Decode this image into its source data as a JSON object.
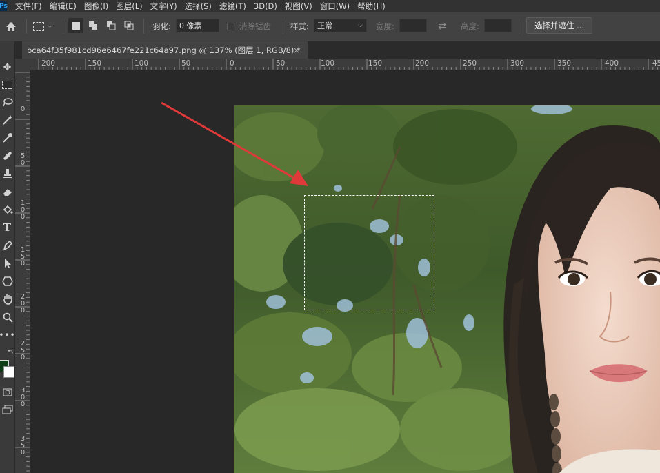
{
  "app": {
    "logo": "Ps"
  },
  "menu": [
    "文件(F)",
    "编辑(E)",
    "图像(I)",
    "图层(L)",
    "文字(Y)",
    "选择(S)",
    "滤镜(T)",
    "3D(D)",
    "视图(V)",
    "窗口(W)",
    "帮助(H)"
  ],
  "options": {
    "feather_label": "羽化:",
    "feather_value": "0 像素",
    "antialias_label": "消除锯齿",
    "style_label": "样式:",
    "style_value": "正常",
    "width_label": "宽度:",
    "height_label": "高度:",
    "select_mask_label": "选择并遮住 ..."
  },
  "document": {
    "tab_title": "bca64f35f981cd96e6467fe221c64a97.png @ 137% (图层 1, RGB/8) *",
    "close_glyph": "×"
  },
  "rulers": {
    "horizontal": [
      "200",
      "150",
      "100",
      "50",
      "0",
      "50",
      "100",
      "150",
      "200",
      "250",
      "300",
      "350",
      "400",
      "45"
    ],
    "vertical": [
      "0",
      "50",
      "100",
      "150",
      "200",
      "250",
      "300",
      "350"
    ]
  },
  "colors": {
    "foreground": "#0f3d16",
    "background": "#ffffff",
    "arrow": "#e0393a"
  },
  "icons": {
    "home": "home-icon",
    "marquee": "rect-marquee-icon",
    "swap": "swap-icon"
  }
}
